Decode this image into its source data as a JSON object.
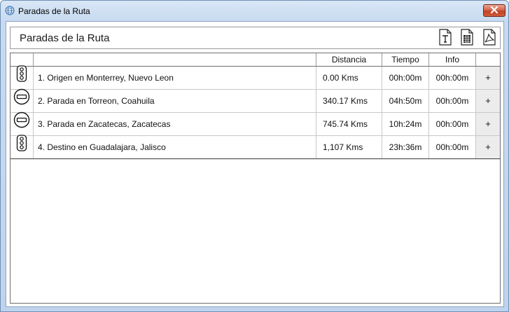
{
  "window": {
    "title": "Paradas de la Ruta"
  },
  "header": {
    "title": "Paradas de la Ruta",
    "buttons": [
      {
        "name": "text-export",
        "icon": "text-document-icon"
      },
      {
        "name": "spreadsheet-export",
        "icon": "spreadsheet-document-icon"
      },
      {
        "name": "pdf-export",
        "icon": "pdf-document-icon"
      }
    ]
  },
  "table": {
    "columns": [
      "",
      "",
      "Distancia",
      "Tiempo",
      "Info",
      ""
    ],
    "rows": [
      {
        "icon": "traffic-light-icon",
        "name": "1. Origen en Monterrey, Nuevo Leon",
        "distance": "0.00 Kms",
        "time": "00h:00m",
        "info": "00h:00m",
        "action": "+"
      },
      {
        "icon": "stop-sign-icon",
        "name": "2. Parada en Torreon, Coahuila",
        "distance": "340.17 Kms",
        "time": "04h:50m",
        "info": "00h:00m",
        "action": "+"
      },
      {
        "icon": "stop-sign-icon",
        "name": "3. Parada en Zacatecas, Zacatecas",
        "distance": "745.74 Kms",
        "time": "10h:24m",
        "info": "00h:00m",
        "action": "+"
      },
      {
        "icon": "traffic-light-icon",
        "name": "4. Destino en Guadalajara, Jalisco",
        "distance": "1,107 Kms",
        "time": "23h:36m",
        "info": "00h:00m",
        "action": "+"
      }
    ]
  }
}
